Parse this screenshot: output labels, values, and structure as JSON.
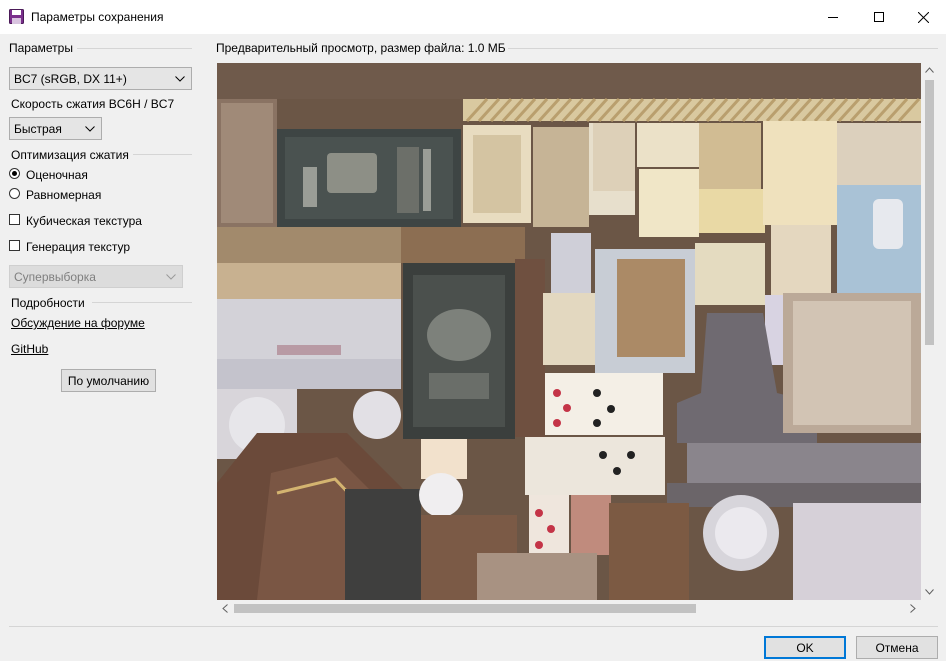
{
  "window": {
    "title": "Параметры сохранения",
    "icon": "floppy-disk-icon",
    "controls": [
      "minimize-icon",
      "maximize-icon",
      "close-icon"
    ]
  },
  "params": {
    "group_label": "Параметры",
    "format_value": "BC7 (sRGB, DX 11+)",
    "speed_label": "Скорость сжатия BC6H / BC7",
    "speed_value": "Быстрая",
    "optimization_label": "Оптимизация сжатия",
    "radio_options": [
      {
        "label": "Оценочная",
        "selected": true
      },
      {
        "label": "Равномерная",
        "selected": false
      }
    ],
    "cubemap_label": "Кубическая текстура",
    "cubemap_checked": false,
    "mipmaps_label": "Генерация текстур",
    "mipmaps_checked": false,
    "supersampling_value": "Супервыборка",
    "details_label": "Подробности",
    "forum_link": "Обсуждение на форуме",
    "github_link": "GitHub",
    "default_button": "По умолчанию"
  },
  "preview": {
    "label": "Предварительный просмотр, размер файла: 1.0 МБ"
  },
  "footer": {
    "ok_label": "OK",
    "cancel_label": "Отмена"
  },
  "colors": {
    "accent": "#0078d7",
    "window_bg": "#f0f0f0"
  }
}
